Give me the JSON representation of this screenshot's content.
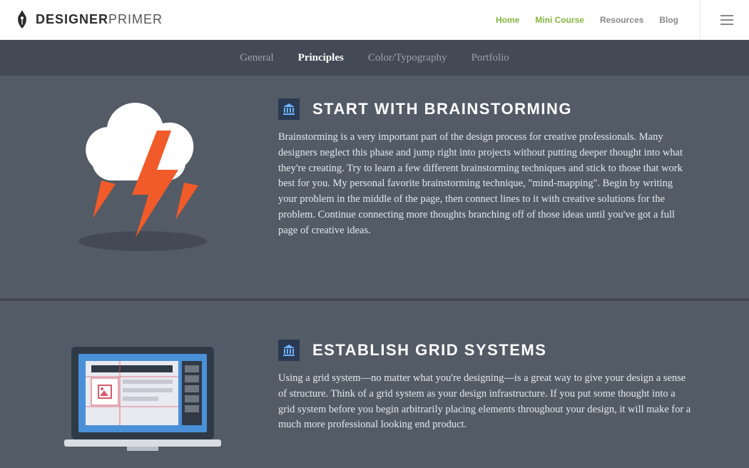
{
  "header": {
    "logo_bold": "DESIGNER",
    "logo_light": "PRIMER",
    "nav": [
      {
        "label": "Home",
        "active": true
      },
      {
        "label": "Mini Course",
        "active": true
      },
      {
        "label": "Resources",
        "active": false
      },
      {
        "label": "Blog",
        "active": false
      }
    ]
  },
  "tabs": [
    {
      "label": "General",
      "active": false
    },
    {
      "label": "Principles",
      "active": true
    },
    {
      "label": "Color/Typography",
      "active": false
    },
    {
      "label": "Portfolio",
      "active": false
    }
  ],
  "sections": [
    {
      "heading": "START WITH BRAINSTORMING",
      "body": "Brainstorming is a very important part of the design process for creative professionals. Many designers neglect this phase and jump right into projects without putting deeper thought into what they're creating. Try to learn a few different brainstorming techniques and stick to those that work best for you. My personal favorite brainstorming technique, \"mind-mapping\". Begin by writing your problem in the middle of the page, then connect lines to it with creative solutions for the problem. Continue connecting more thoughts branching off of those ideas until you've got a full page of creative ideas."
    },
    {
      "heading": "ESTABLISH GRID SYSTEMS",
      "body": "Using a grid system—no matter what you're designing—is a great way to give your design a sense of structure. Think of a grid system as your design infrastructure. If you put some thought into a grid system before you begin arbitrarily placing elements throughout your design, it will make for a much more professional looking end product."
    }
  ]
}
